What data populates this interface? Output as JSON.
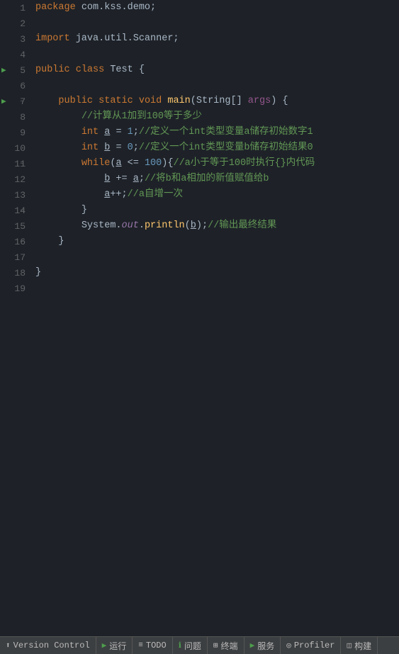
{
  "editor": {
    "background": "#1e2228",
    "lines": [
      {
        "num": 1,
        "indent": 0,
        "tokens": [
          {
            "type": "kw2",
            "text": "package"
          },
          {
            "type": "plain",
            "text": " com.kss.demo;"
          }
        ],
        "hasRun": false,
        "hasFold": false
      },
      {
        "num": 2,
        "indent": 0,
        "tokens": [],
        "hasRun": false,
        "hasFold": false
      },
      {
        "num": 3,
        "indent": 0,
        "tokens": [
          {
            "type": "kw2",
            "text": "import"
          },
          {
            "type": "plain",
            "text": " java.util.Scanner;"
          }
        ],
        "hasRun": false,
        "hasFold": false
      },
      {
        "num": 4,
        "indent": 0,
        "tokens": [],
        "hasRun": false,
        "hasFold": false
      },
      {
        "num": 5,
        "indent": 0,
        "tokens": [
          {
            "type": "kw",
            "text": "public"
          },
          {
            "type": "plain",
            "text": " "
          },
          {
            "type": "kw",
            "text": "class"
          },
          {
            "type": "plain",
            "text": " Test {"
          }
        ],
        "hasRun": true,
        "hasFold": false
      },
      {
        "num": 6,
        "indent": 0,
        "tokens": [],
        "hasRun": false,
        "hasFold": false
      },
      {
        "num": 7,
        "indent": 1,
        "tokens": [
          {
            "type": "kw",
            "text": "public"
          },
          {
            "type": "plain",
            "text": " "
          },
          {
            "type": "kw",
            "text": "static"
          },
          {
            "type": "plain",
            "text": " "
          },
          {
            "type": "kw",
            "text": "void"
          },
          {
            "type": "plain",
            "text": " "
          },
          {
            "type": "method",
            "text": "main"
          },
          {
            "type": "plain",
            "text": "("
          },
          {
            "type": "plain",
            "text": "String[] "
          },
          {
            "type": "param",
            "text": "args"
          },
          {
            "type": "plain",
            "text": ") {"
          }
        ],
        "hasRun": true,
        "hasFold": true
      },
      {
        "num": 8,
        "indent": 2,
        "tokens": [
          {
            "type": "comment",
            "text": "//计算从1加到100等于多少"
          }
        ],
        "hasRun": false,
        "hasFold": false
      },
      {
        "num": 9,
        "indent": 2,
        "tokens": [
          {
            "type": "kw",
            "text": "int"
          },
          {
            "type": "plain",
            "text": " "
          },
          {
            "type": "underline",
            "text": "a"
          },
          {
            "type": "plain",
            "text": " = "
          },
          {
            "type": "number",
            "text": "1"
          },
          {
            "type": "plain",
            "text": ";"
          },
          {
            "type": "comment",
            "text": "//定义一个int类型变量a储存初始数字1"
          }
        ],
        "hasRun": false,
        "hasFold": false
      },
      {
        "num": 10,
        "indent": 2,
        "tokens": [
          {
            "type": "kw",
            "text": "int"
          },
          {
            "type": "plain",
            "text": " "
          },
          {
            "type": "underline",
            "text": "b"
          },
          {
            "type": "plain",
            "text": " = "
          },
          {
            "type": "number",
            "text": "0"
          },
          {
            "type": "plain",
            "text": ";"
          },
          {
            "type": "comment",
            "text": "//定义一个int类型变量b储存初始结果0"
          }
        ],
        "hasRun": false,
        "hasFold": false
      },
      {
        "num": 11,
        "indent": 2,
        "tokens": [
          {
            "type": "kw",
            "text": "while"
          },
          {
            "type": "plain",
            "text": "("
          },
          {
            "type": "underline",
            "text": "a"
          },
          {
            "type": "plain",
            "text": " <= "
          },
          {
            "type": "number",
            "text": "100"
          },
          {
            "type": "plain",
            "text": "){"
          },
          {
            "type": "comment",
            "text": "//a小于等于100时执行{}内代码"
          }
        ],
        "hasRun": false,
        "hasFold": true
      },
      {
        "num": 12,
        "indent": 3,
        "tokens": [
          {
            "type": "underline",
            "text": "b"
          },
          {
            "type": "plain",
            "text": " += "
          },
          {
            "type": "underline",
            "text": "a"
          },
          {
            "type": "plain",
            "text": ";"
          },
          {
            "type": "comment",
            "text": "//将b和a相加的新值赋值给b"
          }
        ],
        "hasRun": false,
        "hasFold": false
      },
      {
        "num": 13,
        "indent": 3,
        "tokens": [
          {
            "type": "underline",
            "text": "a"
          },
          {
            "type": "plain",
            "text": "++;"
          },
          {
            "type": "comment",
            "text": "//a自增一次"
          }
        ],
        "hasRun": false,
        "hasFold": false
      },
      {
        "num": 14,
        "indent": 2,
        "tokens": [
          {
            "type": "plain",
            "text": "}"
          }
        ],
        "hasRun": false,
        "hasFold": true
      },
      {
        "num": 15,
        "indent": 2,
        "tokens": [
          {
            "type": "plain",
            "text": "System."
          },
          {
            "type": "out",
            "text": "out"
          },
          {
            "type": "plain",
            "text": "."
          },
          {
            "type": "method",
            "text": "println"
          },
          {
            "type": "plain",
            "text": "("
          },
          {
            "type": "underline",
            "text": "b"
          },
          {
            "type": "plain",
            "text": ");"
          },
          {
            "type": "comment",
            "text": "//输出最终结果"
          }
        ],
        "hasRun": false,
        "hasFold": false
      },
      {
        "num": 16,
        "indent": 1,
        "tokens": [
          {
            "type": "plain",
            "text": "}"
          }
        ],
        "hasRun": false,
        "hasFold": true
      },
      {
        "num": 17,
        "indent": 0,
        "tokens": [],
        "hasRun": false,
        "hasFold": false
      },
      {
        "num": 18,
        "indent": 0,
        "tokens": [
          {
            "type": "plain",
            "text": "}"
          }
        ],
        "hasRun": false,
        "hasFold": false
      },
      {
        "num": 19,
        "indent": 0,
        "tokens": [],
        "hasRun": false,
        "hasFold": false
      }
    ]
  },
  "statusBar": {
    "items": [
      {
        "id": "version-control",
        "icon": "⬆",
        "label": "Version Control",
        "iconColor": "#bbbbbb"
      },
      {
        "id": "run",
        "icon": "▶",
        "label": "运行",
        "iconColor": "#4e9e4e"
      },
      {
        "id": "todo",
        "icon": "≡",
        "label": "TODO",
        "iconColor": "#bbbbbb"
      },
      {
        "id": "problems",
        "icon": "ℹ",
        "label": "问题",
        "iconColor": "#4e9e4e"
      },
      {
        "id": "terminal",
        "icon": "⊞",
        "label": "终端",
        "iconColor": "#bbbbbb"
      },
      {
        "id": "services",
        "icon": "▶",
        "label": "服务",
        "iconColor": "#4e9e4e"
      },
      {
        "id": "profiler",
        "icon": "◎",
        "label": "Profiler",
        "iconColor": "#bbbbbb"
      },
      {
        "id": "structure",
        "icon": "◫",
        "label": "构建",
        "iconColor": "#bbbbbb"
      }
    ]
  }
}
